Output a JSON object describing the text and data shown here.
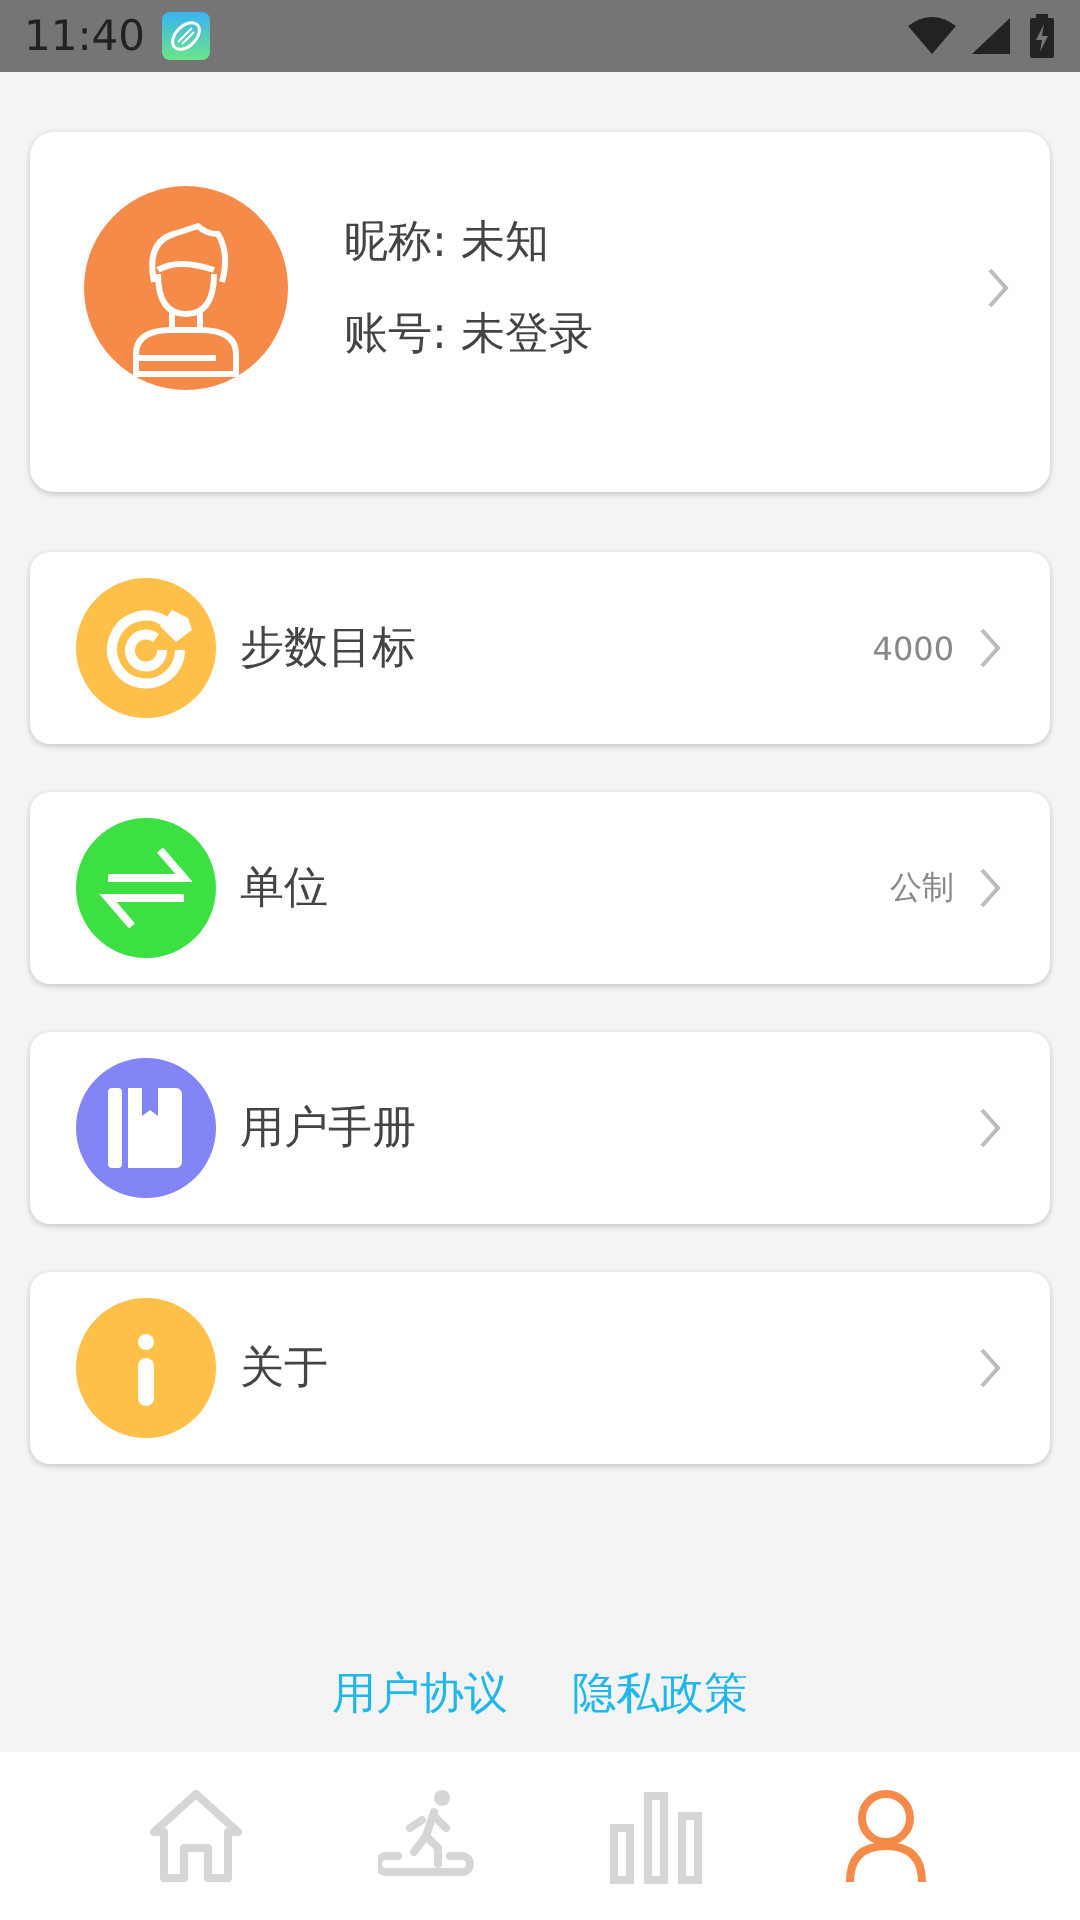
{
  "status_bar": {
    "time": "11:40"
  },
  "profile": {
    "nickname": "昵称: 未知",
    "account": "账号: 未登录"
  },
  "menu": [
    {
      "kind": "target",
      "label": "步数目标",
      "value": "4000",
      "color": "#ffc04a"
    },
    {
      "kind": "unit",
      "label": "单位",
      "value": "公制",
      "color": "#3ce043"
    },
    {
      "kind": "manual",
      "label": "用户手册",
      "color": "#8185f5"
    },
    {
      "kind": "about",
      "label": "关于",
      "color": "#ffc04a"
    }
  ],
  "links": [
    "用户协议",
    "隐私政策"
  ],
  "nav": [
    {
      "kind": "home",
      "selected": false
    },
    {
      "kind": "walk",
      "selected": false
    },
    {
      "kind": "stats",
      "selected": false
    },
    {
      "kind": "profile",
      "selected": true
    }
  ]
}
